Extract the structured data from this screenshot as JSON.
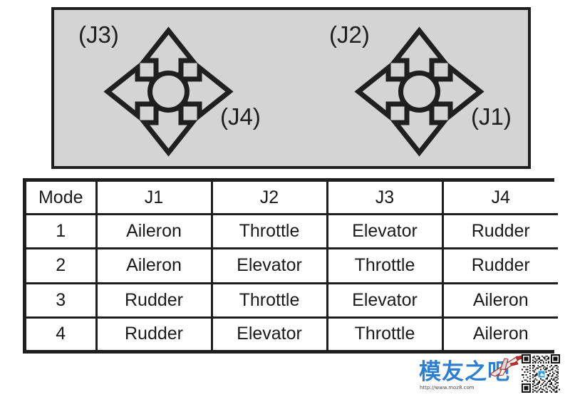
{
  "diagram": {
    "sticks": [
      {
        "id": "left-stick",
        "vertical_label": "(J3)",
        "horizontal_label": "(J4)"
      },
      {
        "id": "right-stick",
        "vertical_label": "(J2)",
        "horizontal_label": "(J1)"
      }
    ],
    "panel_color": "#d4d4d4",
    "outline_color": "#1f1f1f"
  },
  "table": {
    "headers": [
      "Mode",
      "J1",
      "J2",
      "J3",
      "J4"
    ],
    "rows": [
      [
        "1",
        "Aileron",
        "Throttle",
        "Elevator",
        "Rudder"
      ],
      [
        "2",
        "Aileron",
        "Elevator",
        "Throttle",
        "Rudder"
      ],
      [
        "3",
        "Rudder",
        "Throttle",
        "Elevator",
        "Aileron"
      ],
      [
        "4",
        "Rudder",
        "Elevator",
        "Throttle",
        "Aileron"
      ]
    ]
  },
  "watermark": {
    "brand_text": "模友之吧",
    "url": "http://www.moz8.com",
    "brand_color": "#2f7fd0"
  }
}
